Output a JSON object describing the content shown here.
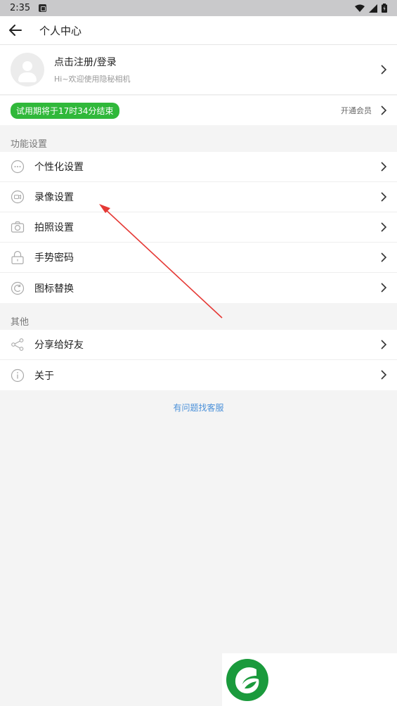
{
  "status_bar": {
    "time": "2:35"
  },
  "app_bar": {
    "title": "个人中心"
  },
  "profile": {
    "name": "点击注册/登录",
    "subtitle": "Hi~欢迎使用隐秘相机"
  },
  "trial": {
    "badge": "试用期将于17时34分结束",
    "vip_label": "开通会员"
  },
  "sections": [
    {
      "label": "功能设置",
      "items": [
        {
          "label": "个性化设置",
          "icon": "more-dots-icon"
        },
        {
          "label": "录像设置",
          "icon": "video-camera-icon"
        },
        {
          "label": "拍照设置",
          "icon": "camera-icon"
        },
        {
          "label": "手势密码",
          "icon": "lock-icon"
        },
        {
          "label": "图标替换",
          "icon": "replace-icon"
        }
      ]
    },
    {
      "label": "其他",
      "items": [
        {
          "label": "分享给好友",
          "icon": "share-icon"
        },
        {
          "label": "关于",
          "icon": "info-icon"
        }
      ]
    }
  ],
  "customer_service": "有问题找客服",
  "colors": {
    "trial_badge": "#30b83a",
    "link": "#4a90d9",
    "annotation_arrow": "#e53935",
    "logo_green": "#1a9a3c"
  }
}
